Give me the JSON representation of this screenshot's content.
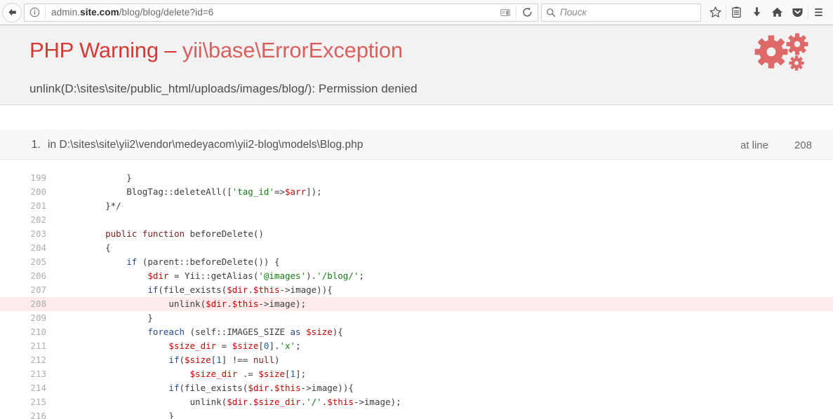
{
  "browser": {
    "back_icon": "back-arrow-icon",
    "identity_icon": "info-circle-icon",
    "url_prefix": "admin.",
    "url_domain": "site.com",
    "url_suffix": "/blog/blog/delete?id=6",
    "reader_icon": "reader-mode-icon",
    "reload_icon": "reload-icon",
    "search_placeholder": "Поиск",
    "search_value": "",
    "search_icon": "search-icon",
    "icons": [
      "star-bookmark-icon",
      "library-icon",
      "download-icon",
      "home-icon",
      "pocket-icon",
      "hamburger-menu-icon"
    ]
  },
  "error": {
    "type": "PHP Warning",
    "separator": " – ",
    "exception": "yii\\base\\ErrorException",
    "message": "unlink(D:\\sites\\site/public_html/uploads/images/blog/): Permission denied",
    "logo_icon": "gears-icon",
    "colors": {
      "type": "#d73a36",
      "exception": "#d9605e",
      "logo": "#dd6a68",
      "header_bg": "#f2f2f2",
      "error_line_bg": "#fdeaea"
    }
  },
  "trace": {
    "index": "1.",
    "file_prefix": "in ",
    "file": "D:\\sites\\site\\yii2\\vendor\\medeyacom\\yii2-blog\\models\\Blog.php",
    "at_line_label": "at line",
    "line_number": "208"
  },
  "code": {
    "highlighted_line": 208,
    "lines": [
      {
        "n": "199",
        "text": "        }"
      },
      {
        "n": "200",
        "text": "        BlogTag::deleteAll(['tag_id'=>$arr]);"
      },
      {
        "n": "201",
        "text": "    }*/"
      },
      {
        "n": "202",
        "text": ""
      },
      {
        "n": "203",
        "text": "    public function beforeDelete()"
      },
      {
        "n": "204",
        "text": "    {"
      },
      {
        "n": "205",
        "text": "        if (parent::beforeDelete()) {"
      },
      {
        "n": "206",
        "text": "            $dir = Yii::getAlias('@images').'/blog/';"
      },
      {
        "n": "207",
        "text": "            if(file_exists($dir.$this->image)){"
      },
      {
        "n": "208",
        "text": "                unlink($dir.$this->image);"
      },
      {
        "n": "209",
        "text": "            }"
      },
      {
        "n": "210",
        "text": "            foreach (self::IMAGES_SIZE as $size){"
      },
      {
        "n": "211",
        "text": "                $size_dir = $size[0].'x';"
      },
      {
        "n": "212",
        "text": "                if($size[1] !== null)"
      },
      {
        "n": "213",
        "text": "                    $size_dir .= $size[1];"
      },
      {
        "n": "214",
        "text": "                if(file_exists($dir.$this->image)){"
      },
      {
        "n": "215",
        "text": "                    unlink($dir.$size_dir.'/'.$this->image);"
      },
      {
        "n": "216",
        "text": "                }"
      }
    ]
  }
}
